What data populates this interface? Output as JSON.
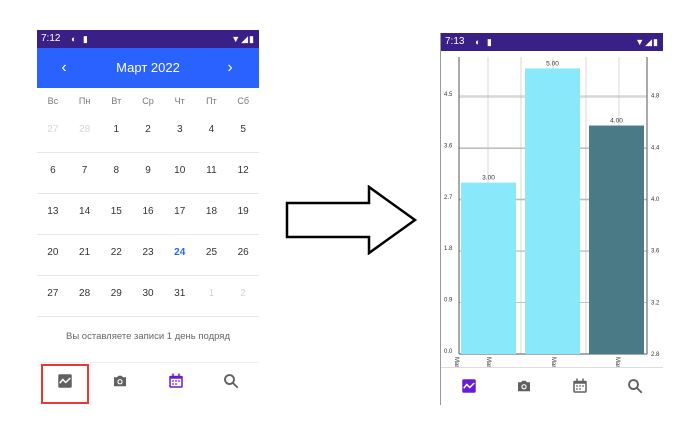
{
  "left_screen": {
    "status": {
      "time": "7:12"
    },
    "calendar": {
      "month_label": "Март 2022",
      "prev_glyph": "‹",
      "next_glyph": "›",
      "weekdays": [
        "Вс",
        "Пн",
        "Вт",
        "Ср",
        "Чт",
        "Пт",
        "Сб"
      ],
      "weeks": [
        [
          "27",
          "28",
          "1",
          "2",
          "3",
          "4",
          "5"
        ],
        [
          "6",
          "7",
          "8",
          "9",
          "10",
          "11",
          "12"
        ],
        [
          "13",
          "14",
          "15",
          "16",
          "17",
          "18",
          "19"
        ],
        [
          "20",
          "21",
          "22",
          "23",
          "24",
          "25",
          "26"
        ],
        [
          "27",
          "28",
          "29",
          "30",
          "31",
          "1",
          "2"
        ]
      ],
      "muted_cells": [
        [
          0,
          0
        ],
        [
          0,
          1
        ],
        [
          4,
          5
        ],
        [
          4,
          6
        ]
      ],
      "today_cell": [
        3,
        4
      ],
      "accent_color": "#2962ff"
    },
    "streak_text": "Вы оставляете записи 1 день подряд",
    "nav": [
      "chart-icon",
      "camera-icon",
      "calendar-icon",
      "search-icon"
    ],
    "active_nav": "calendar-icon",
    "highlight_color": "#e53935"
  },
  "right_screen": {
    "status": {
      "time": "7:13"
    },
    "chart_data": {
      "type": "bar",
      "categories": [
        "Mar 18, 2022",
        "Mar 22, 2022",
        "Mar 24, 2022"
      ],
      "x_labels": [
        "Mar 18, 2022",
        "Mar 18, 2022",
        "Mar 22, 2022",
        "Mar 24, 2022"
      ],
      "values": [
        3.0,
        5.0,
        4.0
      ],
      "value_labels": [
        "3.00",
        "5.00",
        "4.00"
      ],
      "bar_colors": [
        "#8ae8fb",
        "#8ae8fb",
        "#4a7a85"
      ],
      "left_axis": {
        "ylim": [
          0,
          5.2
        ],
        "ticks": [
          "0.0",
          "0.9",
          "1.8",
          "2.7",
          "3.6",
          "4.5"
        ]
      },
      "right_axis": {
        "ylim": [
          2.8,
          5.1
        ],
        "ticks": [
          "2.8",
          "3.2",
          "3.6",
          "4.0",
          "4.4",
          "4.8"
        ]
      },
      "grid": true
    },
    "nav": [
      "chart-icon",
      "camera-icon",
      "calendar-icon",
      "search-icon"
    ],
    "active_nav": "chart-icon"
  },
  "colors": {
    "status_bar": "#3a1f86",
    "header": "#2962ff",
    "active_icon": "#6a1bd2",
    "icon": "#616161"
  }
}
